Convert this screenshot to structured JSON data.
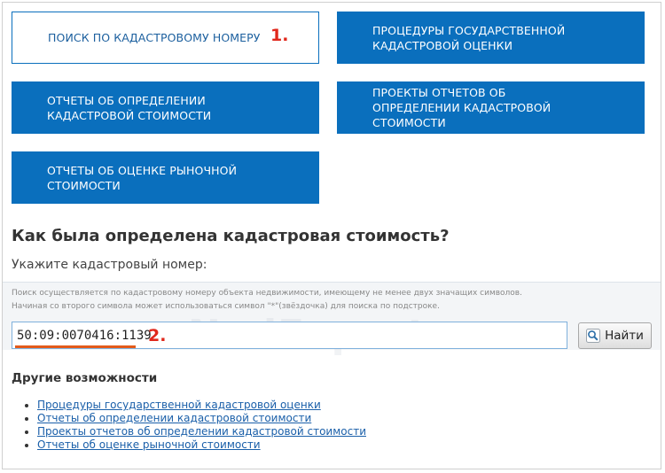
{
  "tiles": {
    "cadastral_search": "ПОИСК ПО КАДАСТРОВОМУ НОМЕРУ",
    "state_valuation": "ПРОЦЕДУРЫ ГОСУДАРСТВЕННОЙ КАДАСТРОВОЙ ОЦЕНКИ",
    "value_reports": "ОТЧЕТЫ ОБ ОПРЕДЕЛЕНИИ КАДАСТРОВОЙ СТОИМОСТИ",
    "draft_reports": "ПРОЕКТЫ ОТЧЕТОВ ОБ ОПРЕДЕЛЕНИИ КАДАСТРОВОЙ СТОИМОСТИ",
    "market_reports": "ОТЧЕТЫ ОБ ОЦЕНКЕ РЫНОЧНОЙ СТОИМОСТИ"
  },
  "markers": {
    "first": "1.",
    "second": "2."
  },
  "search": {
    "title": "Как была определена кадастровая стоимость?",
    "prompt": "Укажите кадастровый номер:",
    "hint_line1": "Поиск осуществляется по кадастровому номеру объекта недвижимости, имеющему не менее двух значащих символов.",
    "hint_line2": "Начиная со второго символа может использоваться символ \"*\"(звёздочка) для поиска по подстроке.",
    "input_value": "50:09:0070416:1139",
    "button_label": "Найти",
    "icon": "magnifier-icon"
  },
  "watermark": "NedExpert.ru",
  "other": {
    "title": "Другие возможности",
    "links": [
      "Процедуры государственной кадастровой оценки",
      "Отчеты об определении кадастровой стоимости",
      "Проекты отчетов об определении кадастровой стоимости",
      "Отчеты об оценке рыночной стоимости"
    ]
  },
  "colors": {
    "tile_blue": "#0a6fbd",
    "marker_red": "#e0281c",
    "link_blue": "#1a5fa9",
    "underline_orange": "#e35a1a"
  }
}
